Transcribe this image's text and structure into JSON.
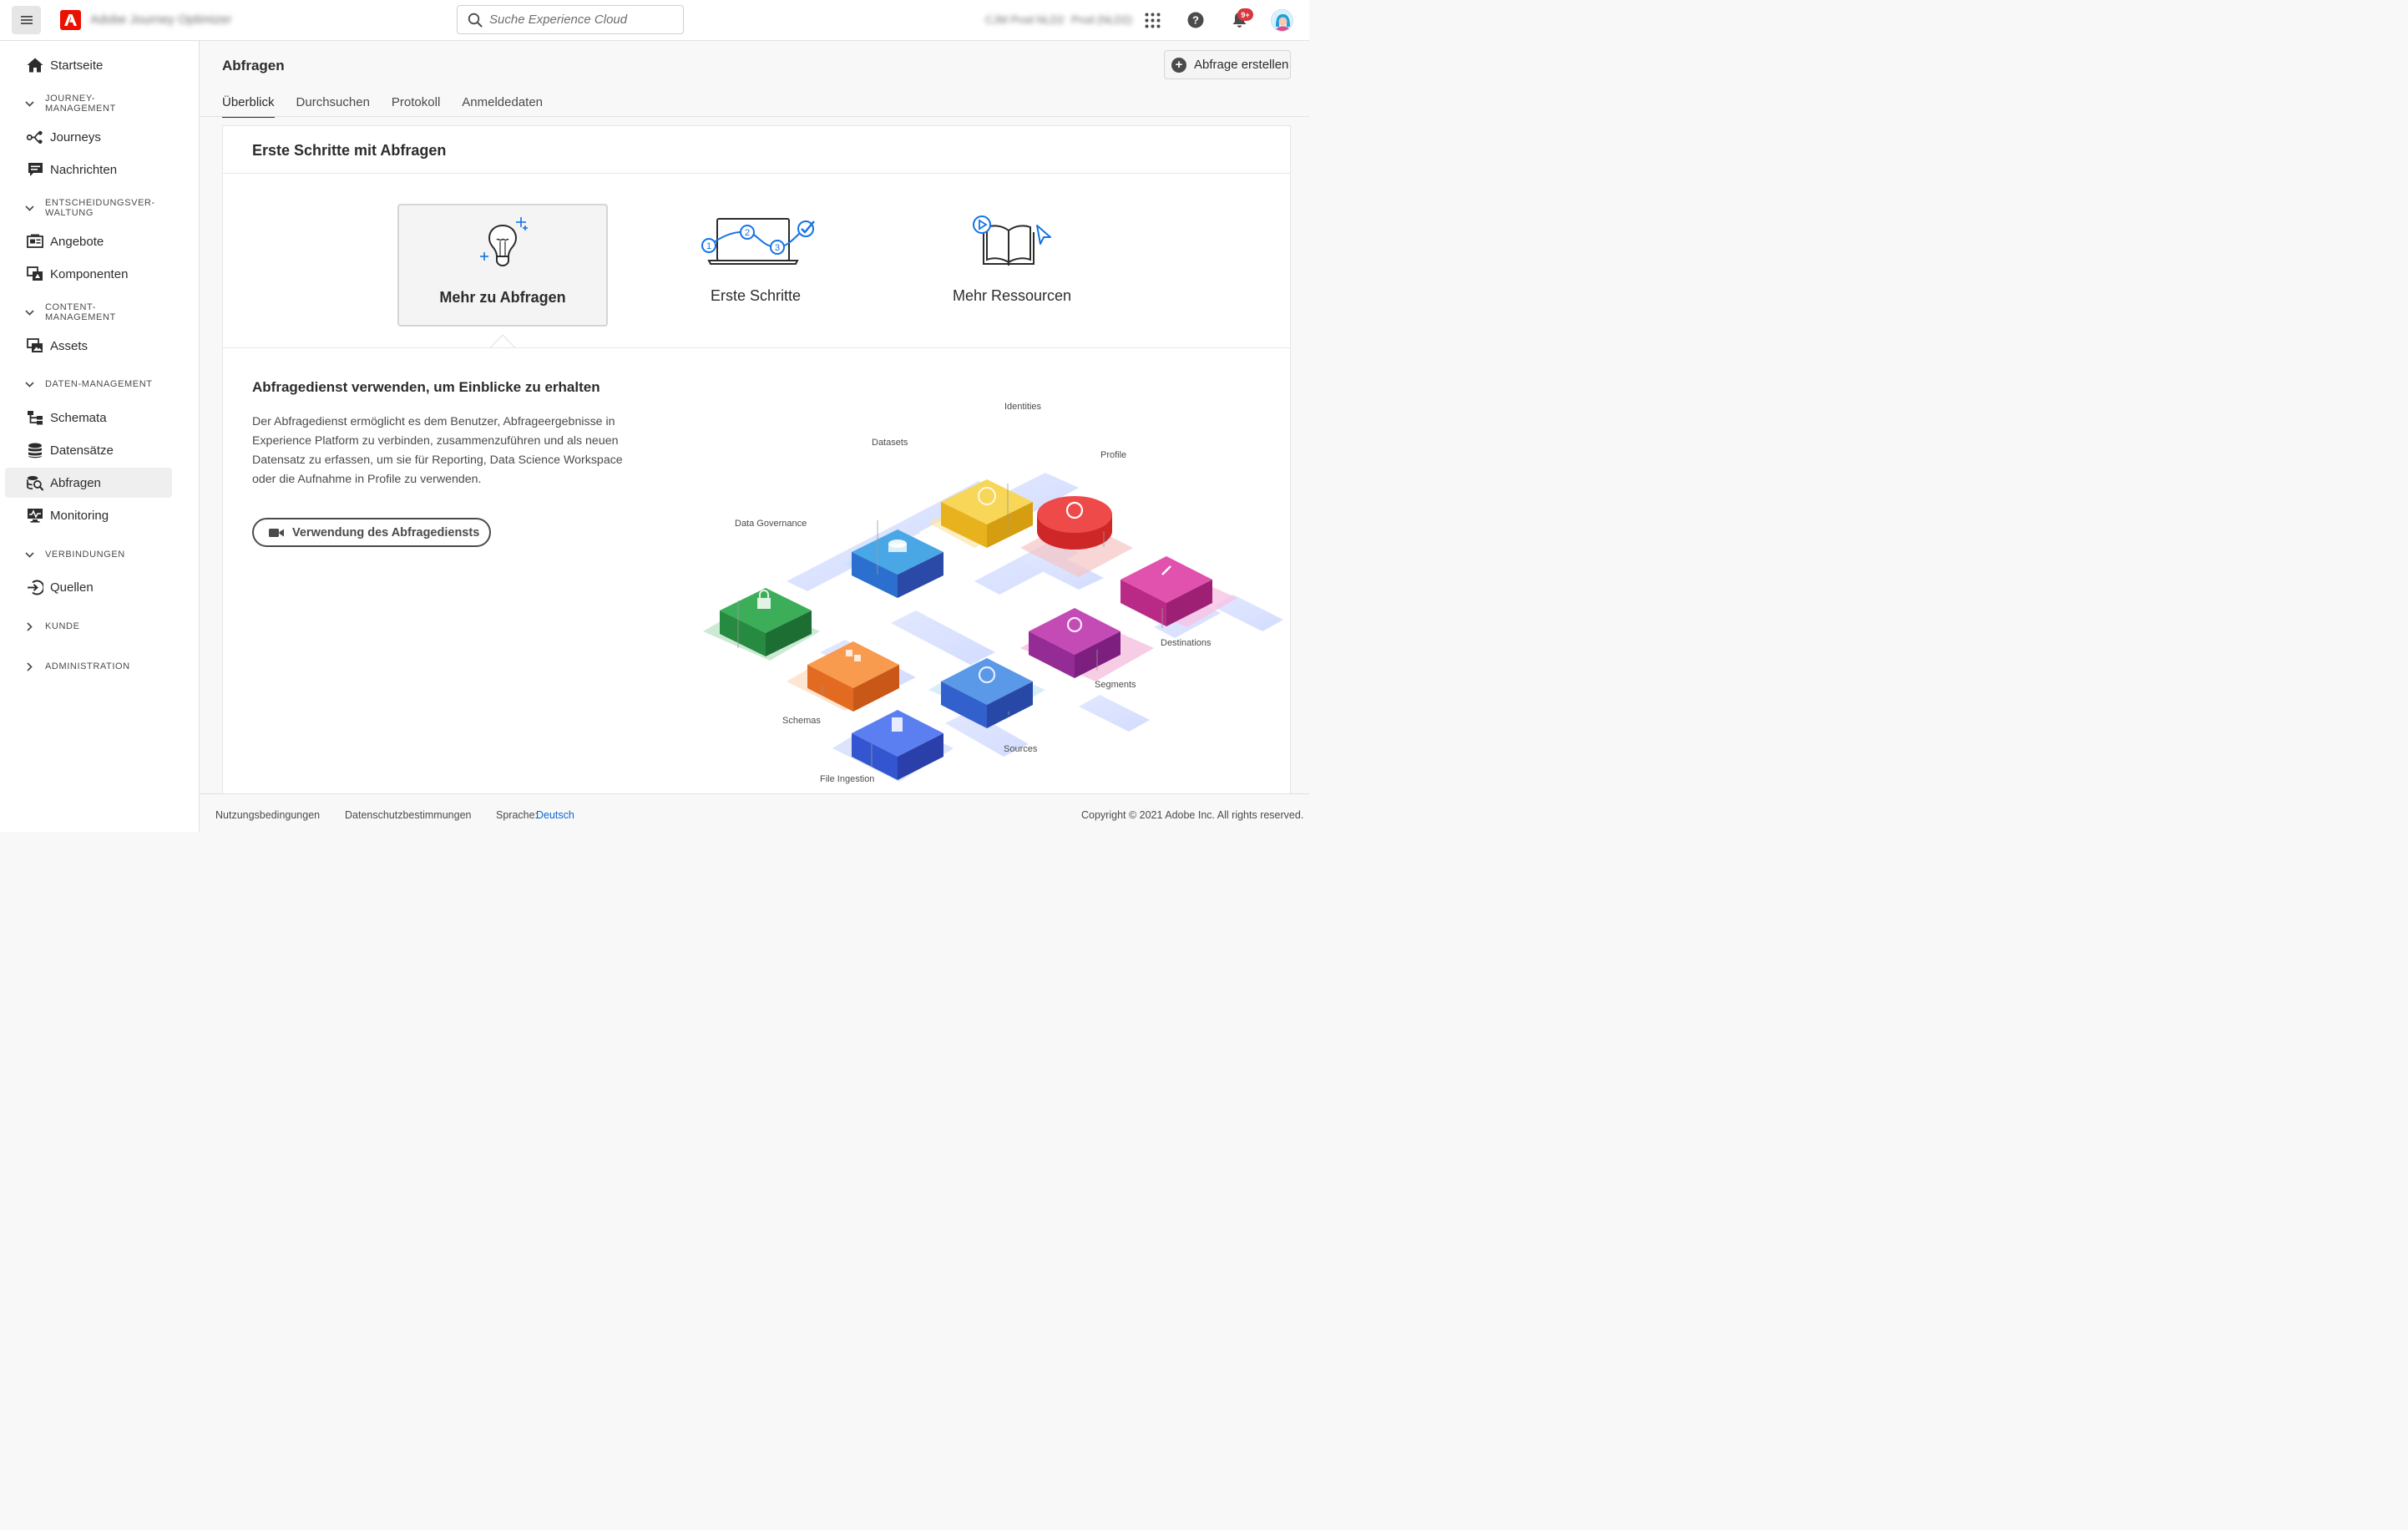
{
  "topbar": {
    "app_title": "Adobe Journey Optimizer",
    "search_placeholder": "Suche Experience Cloud",
    "org1": "CJM Prod NLD2",
    "org2": "Prod (NLD2)",
    "notification_badge": "9+",
    "icons": [
      "hamburger-icon",
      "adobe-logo-icon",
      "search-icon",
      "apps-grid-icon",
      "help-icon",
      "bell-icon",
      "avatar"
    ]
  },
  "sidebar": {
    "items": [
      {
        "type": "item",
        "label": "Startseite",
        "icon": "home-icon"
      },
      {
        "type": "section",
        "label": "JOURNEY-\nMANAGEMENT",
        "expanded": true
      },
      {
        "type": "item",
        "label": "Journeys",
        "icon": "journeys-icon"
      },
      {
        "type": "item",
        "label": "Nachrichten",
        "icon": "messages-icon"
      },
      {
        "type": "section",
        "label": "ENTSCHEIDUNGSVER-\nWALTUNG",
        "expanded": true
      },
      {
        "type": "item",
        "label": "Angebote",
        "icon": "offers-icon"
      },
      {
        "type": "item",
        "label": "Komponenten",
        "icon": "components-icon"
      },
      {
        "type": "section",
        "label": "CONTENT-\nMANAGEMENT",
        "expanded": true
      },
      {
        "type": "item",
        "label": "Assets",
        "icon": "assets-icon"
      },
      {
        "type": "section",
        "label": "DATEN-MANAGEMENT",
        "expanded": true
      },
      {
        "type": "item",
        "label": "Schemata",
        "icon": "schema-icon"
      },
      {
        "type": "item",
        "label": "Datensätze",
        "icon": "datasets-icon"
      },
      {
        "type": "item",
        "label": "Abfragen",
        "icon": "queries-icon",
        "active": true
      },
      {
        "type": "item",
        "label": "Monitoring",
        "icon": "monitoring-icon"
      },
      {
        "type": "section",
        "label": "VERBINDUNGEN",
        "expanded": true
      },
      {
        "type": "item",
        "label": "Quellen",
        "icon": "sources-icon"
      },
      {
        "type": "section",
        "label": "KUNDE",
        "expanded": false
      },
      {
        "type": "section",
        "label": "ADMINISTRATION",
        "expanded": false
      }
    ]
  },
  "main": {
    "title": "Abfragen",
    "create_button": "Abfrage erstellen",
    "tabs": [
      "Überblick",
      "Durchsuchen",
      "Protokoll",
      "Anmeldedaten"
    ],
    "active_tab": "Überblick",
    "card_title": "Erste Schritte mit Abfragen",
    "tiles": [
      {
        "label": "Mehr zu Abfragen",
        "icon": "lightbulb-icon",
        "selected": true
      },
      {
        "label": "Erste Schritte",
        "icon": "steps-laptop-icon",
        "selected": false
      },
      {
        "label": "Mehr Ressourcen",
        "icon": "book-play-icon",
        "selected": false
      }
    ],
    "section_title": "Abfragedienst verwenden, um Einblicke zu erhalten",
    "section_body": "Der Abfragedienst ermöglicht es dem Benutzer, Abfrageergebnisse in Experience Platform zu verbinden, zusammenzuführen und als neuen Datensatz zu erfassen, um sie für Reporting, Data Science Workspace oder die Aufnahme in Profile zu verwenden.",
    "video_button": "Verwendung des Abfragediensts",
    "diagram_labels": {
      "identities": "Identities",
      "datasets": "Datasets",
      "profile": "Profile",
      "data_governance": "Data Governance",
      "destinations": "Destinations",
      "segments": "Segments",
      "schemas": "Schemas",
      "sources": "Sources",
      "file_ingestion": "File Ingestion"
    },
    "colors": {
      "identities": "#f2c232",
      "datasets": "#2f78d8",
      "profile": "#e23c3c",
      "data_governance": "#2e9a48",
      "destinations": "#c7308f",
      "segments": "#a23296",
      "schemas": "#f07a32",
      "sources": "#3a67d4",
      "file_ingestion": "#3d5fd6"
    }
  },
  "footer": {
    "terms": "Nutzungsbedingungen",
    "privacy": "Datenschutzbestimmungen",
    "language_label": "Sprache:",
    "language_value": "Deutsch",
    "copyright": "Copyright  ©  2021 Adobe Inc.  All rights reserved."
  }
}
